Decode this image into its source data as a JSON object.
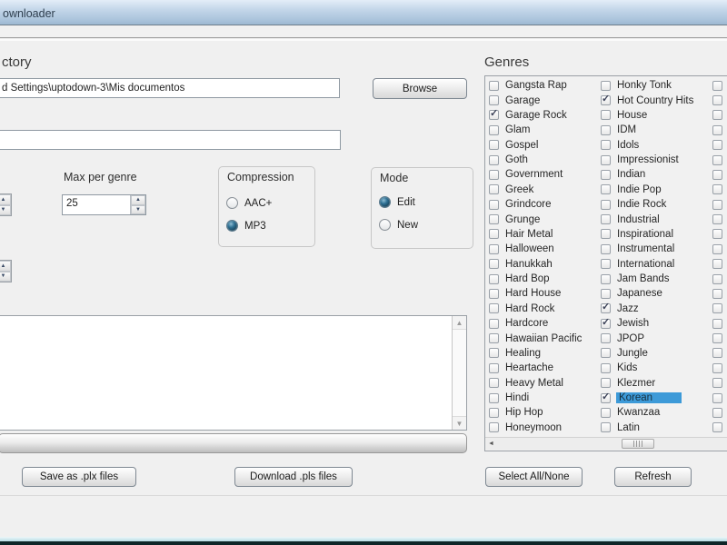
{
  "window": {
    "title": "ownloader"
  },
  "icons": {
    "check": "✓",
    "spin_up": "▲",
    "spin_down": "▼",
    "scroll_up": "▲",
    "scroll_down": "▼",
    "scroll_left": "◄"
  },
  "directory": {
    "label": "ctory",
    "path_value": "d Settings\\uptodown-3\\Mis documentos",
    "browse_label": "Browse",
    "second_field_value": ""
  },
  "options": {
    "max_per_genre": {
      "label": "Max per genre",
      "value": "25"
    },
    "compression": {
      "label": "Compression",
      "items": [
        "AAC+",
        "MP3"
      ],
      "selected": "MP3"
    },
    "mode": {
      "label": "Mode",
      "items": [
        "Edit",
        "New"
      ],
      "selected": "Edit"
    }
  },
  "playlist_area": {
    "content": ""
  },
  "actions": {
    "save": "Save as .plx files",
    "download": "Download .pls files",
    "select_all": "Select All/None",
    "refresh": "Refresh"
  },
  "genres": {
    "label": "Genres",
    "selection_color": "#3d9ad8",
    "columns": [
      {
        "items": [
          {
            "label": "Gangsta Rap",
            "checked": false
          },
          {
            "label": "Garage",
            "checked": false
          },
          {
            "label": "Garage Rock",
            "checked": true
          },
          {
            "label": "Glam",
            "checked": false
          },
          {
            "label": "Gospel",
            "checked": false
          },
          {
            "label": "Goth",
            "checked": false
          },
          {
            "label": "Government",
            "checked": false
          },
          {
            "label": "Greek",
            "checked": false
          },
          {
            "label": "Grindcore",
            "checked": false
          },
          {
            "label": "Grunge",
            "checked": false
          },
          {
            "label": "Hair Metal",
            "checked": false
          },
          {
            "label": "Halloween",
            "checked": false
          },
          {
            "label": "Hanukkah",
            "checked": false
          },
          {
            "label": "Hard Bop",
            "checked": false
          },
          {
            "label": "Hard House",
            "checked": false
          },
          {
            "label": "Hard Rock",
            "checked": false
          },
          {
            "label": "Hardcore",
            "checked": false
          },
          {
            "label": "Hawaiian Pacific",
            "checked": false
          },
          {
            "label": "Healing",
            "checked": false
          },
          {
            "label": "Heartache",
            "checked": false
          },
          {
            "label": "Heavy Metal",
            "checked": false
          },
          {
            "label": "Hindi",
            "checked": false
          },
          {
            "label": "Hip Hop",
            "checked": false
          },
          {
            "label": "Honeymoon",
            "checked": false
          }
        ]
      },
      {
        "items": [
          {
            "label": "Honky Tonk",
            "checked": false
          },
          {
            "label": "Hot Country Hits",
            "checked": true
          },
          {
            "label": "House",
            "checked": false
          },
          {
            "label": "IDM",
            "checked": false
          },
          {
            "label": "Idols",
            "checked": false
          },
          {
            "label": "Impressionist",
            "checked": false
          },
          {
            "label": "Indian",
            "checked": false
          },
          {
            "label": "Indie Pop",
            "checked": false
          },
          {
            "label": "Indie Rock",
            "checked": false
          },
          {
            "label": "Industrial",
            "checked": false
          },
          {
            "label": "Inspirational",
            "checked": false
          },
          {
            "label": "Instrumental",
            "checked": false
          },
          {
            "label": "International",
            "checked": false
          },
          {
            "label": "Jam Bands",
            "checked": false
          },
          {
            "label": "Japanese",
            "checked": false
          },
          {
            "label": "Jazz",
            "checked": true
          },
          {
            "label": "Jewish",
            "checked": true
          },
          {
            "label": "JPOP",
            "checked": false
          },
          {
            "label": "Jungle",
            "checked": false
          },
          {
            "label": "Kids",
            "checked": false
          },
          {
            "label": "Klezmer",
            "checked": false
          },
          {
            "label": "Korean",
            "checked": true,
            "selected": true
          },
          {
            "label": "Kwanzaa",
            "checked": false
          },
          {
            "label": "Latin",
            "checked": false
          }
        ]
      }
    ],
    "column3_checkbox_count": 24
  }
}
